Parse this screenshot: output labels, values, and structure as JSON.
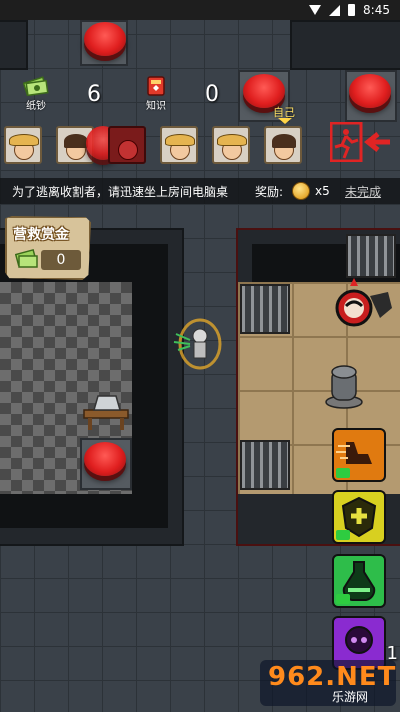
{
  "status_bar": {
    "time": "8:45"
  },
  "resources": [
    {
      "label": "纸钞",
      "value": "6",
      "icon": "cash-icon"
    },
    {
      "label": "知识",
      "value": "0",
      "icon": "book-icon"
    }
  ],
  "self_label": "自己",
  "players": [
    {
      "icon": "straw-hat-player-avatar"
    },
    {
      "icon": "brown-hair-player-avatar"
    },
    {
      "icon": "reaper-avatar"
    },
    {
      "icon": "straw-hat-player-avatar"
    },
    {
      "icon": "straw-hat-player-avatar"
    },
    {
      "icon": "self-player-avatar"
    }
  ],
  "mission": {
    "text": "为了逃离收割者，请迅速坐上房间电脑桌",
    "reward_label": "奖励:",
    "reward_multiplier": "x5",
    "status": "未完成"
  },
  "bounty": {
    "title": "营救赏金",
    "value": "0"
  },
  "skills": [
    {
      "icon": "speed-boots-skill-icon",
      "color": "#e07a10"
    },
    {
      "icon": "shield-heal-skill-icon",
      "color": "#d8d020"
    },
    {
      "icon": "potion-skill-icon",
      "color": "#2ebd4a"
    },
    {
      "icon": "skull-skill-icon",
      "color": "#8a2bd0",
      "count": "1"
    }
  ],
  "watermark": {
    "brand": "962.NET",
    "sub": "乐游网"
  }
}
